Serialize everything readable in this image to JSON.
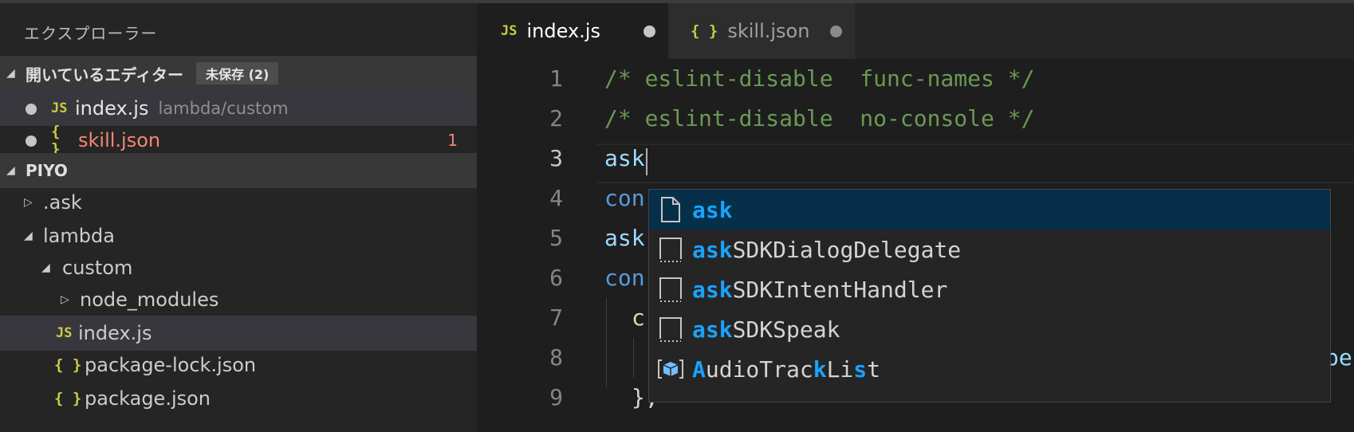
{
  "sidebar": {
    "title": "エクスプローラー",
    "open_editors": {
      "label": "開いているエディター",
      "badge": "未保存 (2)",
      "items": [
        {
          "name": "index.js",
          "icon": "JS",
          "description": "lambda/custom"
        },
        {
          "name": "skill.json",
          "icon": "{ }",
          "error_count": "1"
        }
      ]
    },
    "workspace": {
      "label": "PIYO",
      "tree": [
        {
          "name": ".ask",
          "icon": ""
        },
        {
          "name": "lambda",
          "icon": ""
        },
        {
          "name": "custom",
          "icon": ""
        },
        {
          "name": "node_modules",
          "icon": ""
        },
        {
          "name": "index.js",
          "icon": "JS"
        },
        {
          "name": "package-lock.json",
          "icon": "{ }"
        },
        {
          "name": "package.json",
          "icon": "{ }"
        }
      ]
    }
  },
  "tabs": [
    {
      "icon": "JS",
      "label": "index.js"
    },
    {
      "icon": "{ }",
      "label": "skill.json"
    }
  ],
  "editor": {
    "lines": [
      {
        "number": "1",
        "text": "/* eslint-disable  func-names */"
      },
      {
        "number": "2",
        "text": "/* eslint-disable  no-console */"
      },
      {
        "number": "3",
        "text": "ask"
      },
      {
        "number": "4",
        "text": "con"
      },
      {
        "number": "5",
        "text": "ask"
      },
      {
        "number": "6",
        "text": "con"
      },
      {
        "number": "7",
        "text": "c"
      },
      {
        "number": "8",
        "text": "pe"
      },
      {
        "number": "9",
        "text": "},"
      }
    ]
  },
  "suggestions": [
    {
      "icon": "file-icon",
      "match": "ask",
      "rest": ""
    },
    {
      "icon": "snippet-icon",
      "match": "ask",
      "rest": "SDKDialogDelegate"
    },
    {
      "icon": "snippet-icon",
      "match": "ask",
      "rest": "SDKIntentHandler"
    },
    {
      "icon": "snippet-icon",
      "match": "ask",
      "rest": "SDKSpeak"
    },
    {
      "icon": "module-icon",
      "segments": [
        "A",
        "udioTrac",
        "k",
        "Li",
        "s",
        "t"
      ]
    }
  ],
  "colors": {
    "accent_match": "#18a3ff",
    "error": "#f48771",
    "comment": "#6a9955",
    "js_icon": "#cbcb41"
  }
}
